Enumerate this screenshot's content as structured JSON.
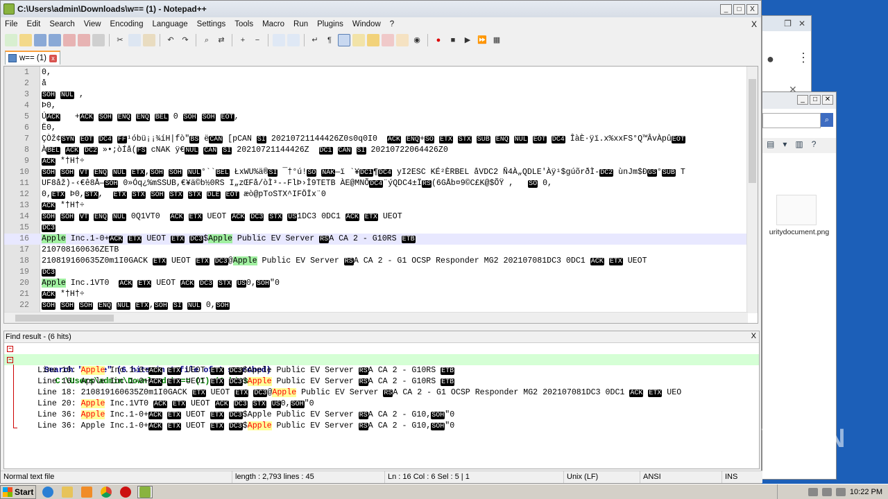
{
  "window": {
    "title": "C:\\Users\\admin\\Downloads\\w== (1) - Notepad++",
    "min": "_",
    "max": "□",
    "close": "X"
  },
  "menu": [
    "File",
    "Edit",
    "Search",
    "View",
    "Encoding",
    "Language",
    "Settings",
    "Tools",
    "Macro",
    "Run",
    "Plugins",
    "Window",
    "?"
  ],
  "menu_close": "X",
  "tab": {
    "label": "w== (1)",
    "close": "x"
  },
  "editor": {
    "lines": [
      {
        "n": "1",
        "t": "0,"
      },
      {
        "n": "2",
        "t": "å"
      },
      {
        "n": "3",
        "t": "SOH NUL ,"
      },
      {
        "n": "4",
        "t": "Þ0,"
      },
      {
        "n": "5",
        "t": "ÚACK   +ACK SOH ENQ ENQ BEL 0 SOH SOH EOT,"
      },
      {
        "n": "6",
        "t": "Ë0,"
      },
      {
        "n": "7",
        "t": "ÇÒž¢SYN EOT DC4 FF¹óbü¡¡¾íH|fò\"BS ëCAN [pCAN SI 20210721144426Z0s0q0I0  ACK ENQ+SO ETX STX SUB ENQ NUL EOT DC4 ÎàÈ·ÿï.x%xxFS°Q™ÂvÀpûEOT"
      },
      {
        "n": "8",
        "t": "ÀBEL ACK DC2 »•;òÍå(FS cNAK ÿ€NUL CAN SI 20210721144426Z  DC1 CAN SI 20210722064426Z0"
      },
      {
        "n": "9",
        "t": "ACK *†H†÷"
      },
      {
        "n": "10",
        "t": "SOH SOH VT ENQ NUL ETX,SOH SOH NUL°``BEL ŁxWU%ä®SI ¯†°ú!SO NAK—ï `¥DC1¶DC4 yI2ESC KÉ²ÈRBEL åVDC2 Ñ4À„QDLE'Àÿ¹$gúõrðÌ-DC2 ùnJm$ÐGS°SUB T"
      },
      {
        "n": "11",
        "t": "UF8åž)-‹€ê8Å—SOH 0»Óq¿%mSSUB,€¥ä©b½0RS I„zŒFå/òÌ³--FlÞ›Î9TETB ÀE@MNÕDC4¨ýQDC4±ÏRS(6GÅb¤9©C£K@$ÕŸ ,   SO 0,"
      },
      {
        "n": "12",
        "t": "0,ETX Þ0,STX,  ETX STX SOH STX STX DLE EOT æò@pToSTX^IFÖÏx¨0"
      },
      {
        "n": "13",
        "t": "ACK *†H†÷"
      },
      {
        "n": "14",
        "t": "SOH SOH VT ENQ NUL 0Q1VT0  ACK ETX UEOT ACK DC3 STX US1DC3 0DC1 ACK ETX UEOT"
      },
      {
        "n": "15",
        "t": "DC3"
      },
      {
        "n": "16",
        "t": "Apple Inc.1-0+ACK ETX UEOT ETX DC3$Apple Public EV Server RSA CA 2 - G10RS ETB"
      },
      {
        "n": "17",
        "t": "210708160636ZETB"
      },
      {
        "n": "18",
        "t": "210819160635Z0m1I0GACK ETX UEOT ETX DC3@Apple Public EV Server RSA CA 2 - G1 OCSP Responder MG2 202107081DC3 0DC1 ACK ETX UEOT"
      },
      {
        "n": "19",
        "t": "DC3"
      },
      {
        "n": "20",
        "t": "Apple Inc.1VT0  ACK ETX UEOT ACK DC3 STX US0,SOH\"0"
      },
      {
        "n": "21",
        "t": "ACK *†H†÷"
      },
      {
        "n": "22",
        "t": "SOH SOH SOH ENQ NUL ETX,SOH SI NUL 0,SOH"
      }
    ]
  },
  "find": {
    "header": "Find result - (6 hits)",
    "close": "X",
    "search_line": "Search \"apple\" (6 hits in 1 file of 1 searched)",
    "file_line": "C:\\Users\\admin\\Downloads\\w== (1) (6 hits)",
    "hits": [
      {
        "pre": "Line 16: ",
        "kw": "Apple",
        "post": " Inc.1-0+ACK ETX UEOT ETX DC3$Apple Public EV Server RSA CA 2 - G10RS ETB"
      },
      {
        "pre": "Line 16: Apple Inc.1-0+ACK ETX UEOT ETX DC3$",
        "kw": "Apple",
        "post": " Public EV Server RSA CA 2 - G10RS ETB"
      },
      {
        "pre": "Line 18: 210819160635Z0m1I0GACK ETX UEOT ETX DC3@",
        "kw": "Apple",
        "post": " Public EV Server RSA CA 2 - G1 OCSP Responder MG2 202107081DC3 0DC1 ACK ETX UEO"
      },
      {
        "pre": "Line 20: ",
        "kw": "Apple",
        "post": " Inc.1VT0 ACK ETX UEOT ACK DC3 STX US0,SOH\"0"
      },
      {
        "pre": "Line 36: ",
        "kw": "Apple",
        "post": " Inc.1-0+ACK ETX UEOT ETX DC3$Apple Public EV Server RSA CA 2 - G10,SOH\"0"
      },
      {
        "pre": "Line 36: Apple Inc.1-0+ACK ETX UEOT ETX DC3$",
        "kw": "Apple",
        "post": " Public EV Server RSA CA 2 - G10,SOH\"0"
      }
    ]
  },
  "status": {
    "type": "Normal text file",
    "length": "length : 2,793   lines : 45",
    "pos": "Ln : 16   Col : 6   Sel : 5 | 1",
    "eol": "Unix (LF)",
    "enc": "ANSI",
    "ins": "INS"
  },
  "explorer": {
    "file_label": "uritydocument.png"
  },
  "taskbar": {
    "start": "Start",
    "clock": "10:22 PM"
  },
  "watermark": "ANY RUN"
}
